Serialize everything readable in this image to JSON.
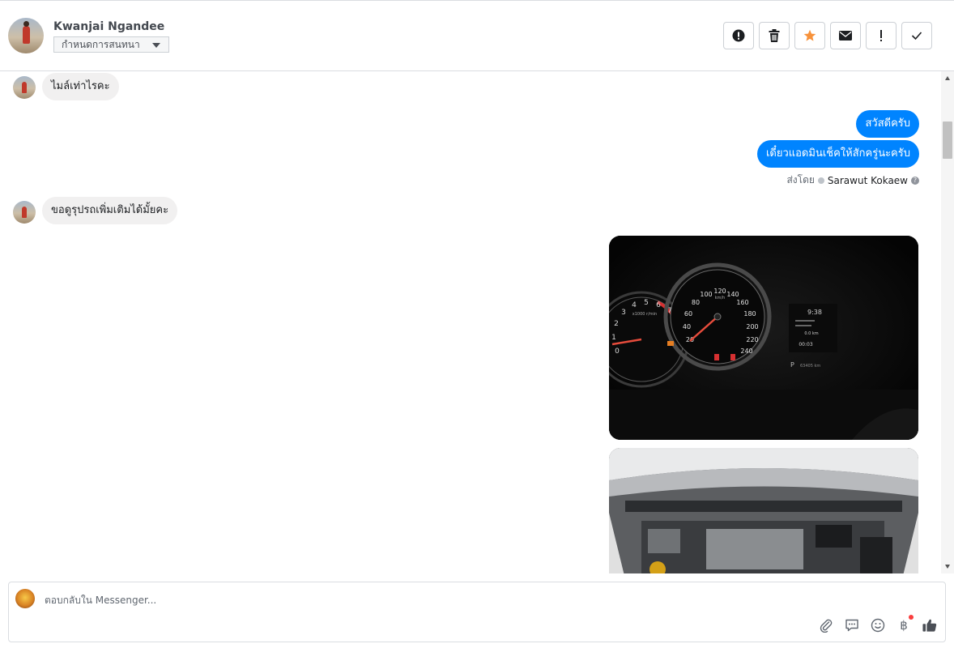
{
  "header": {
    "contact_name": "Kwanjai Ngandee",
    "conversation_select": "กำหนดการสนทนา",
    "actions": [
      {
        "name": "report-button",
        "icon": "alert-circle-icon"
      },
      {
        "name": "delete-button",
        "icon": "trash-icon"
      },
      {
        "name": "star-button",
        "icon": "star-icon",
        "color": "#f7923b"
      },
      {
        "name": "mark-unread-button",
        "icon": "envelope-icon"
      },
      {
        "name": "important-button",
        "icon": "exclamation-icon"
      },
      {
        "name": "done-button",
        "icon": "check-icon"
      }
    ]
  },
  "messages": [
    {
      "from": "customer",
      "text": "ไมล์เท่าไรคะ"
    },
    {
      "from": "page",
      "text": "สวัสดีครับ"
    },
    {
      "from": "page",
      "text": "เดี๋ยวแอดมินเช็คให้สักครู่นะครับ"
    },
    {
      "from": "customer",
      "text": "ขอดูรุปรถเพิ่มเติมได้มั้ยคะ"
    }
  ],
  "sent_by": {
    "prefix": "ส่งโดย",
    "agent": "Sarawut Kokaew",
    "help": "?"
  },
  "photos": {
    "dashboard": {
      "speed_ticks": [
        "20",
        "40",
        "60",
        "80",
        "100",
        "120",
        "140",
        "160",
        "180",
        "200",
        "220",
        "240"
      ],
      "rpm_ticks": [
        "0",
        "1",
        "2",
        "3",
        "4",
        "5",
        "6",
        "7"
      ],
      "rpm_unit": "x1000 r/min",
      "speed_unit": "km/h",
      "clock": "9:38",
      "trip_time": "00:03",
      "distance": "0.0 km",
      "odometer": "63405 km",
      "gear": "P"
    }
  },
  "composer": {
    "placeholder": "ตอบกลับใน Messenger...",
    "tools": [
      "attachment-icon",
      "saved-reply-icon",
      "emoji-icon",
      "payment-baht-icon",
      "like-icon"
    ],
    "baht_symbol": "฿"
  },
  "colors": {
    "outgoing_bubble": "#0084ff",
    "incoming_bubble": "#f1f0f0",
    "star": "#f7923b",
    "notification_dot": "#fa3e3e"
  }
}
